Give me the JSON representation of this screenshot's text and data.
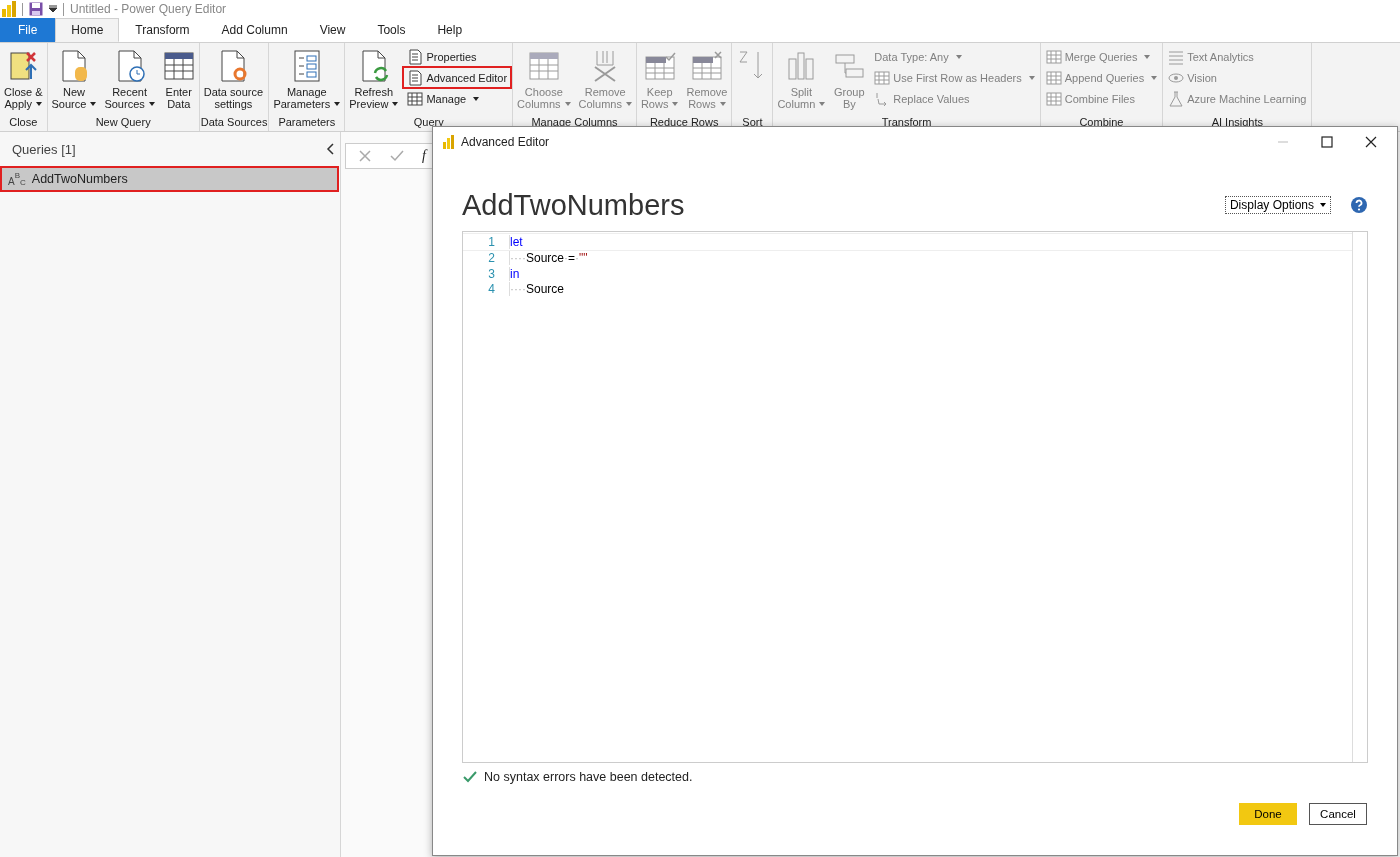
{
  "title_bar": {
    "title": "Untitled - Power Query Editor"
  },
  "tabs": [
    {
      "label": "File",
      "kind": "file",
      "selected": false
    },
    {
      "label": "Home",
      "kind": "tab",
      "selected": true
    },
    {
      "label": "Transform",
      "kind": "tab",
      "selected": false
    },
    {
      "label": "Add Column",
      "kind": "tab",
      "selected": false
    },
    {
      "label": "View",
      "kind": "tab",
      "selected": false
    },
    {
      "label": "Tools",
      "kind": "tab",
      "selected": false
    },
    {
      "label": "Help",
      "kind": "tab",
      "selected": false
    }
  ],
  "ribbon_groups": [
    {
      "label": "Close",
      "items": [
        {
          "kind": "large",
          "lines": [
            "Close &",
            "Apply"
          ],
          "dropdown": true,
          "disabled": false,
          "highlighted": false
        }
      ]
    },
    {
      "label": "New Query",
      "items": [
        {
          "kind": "large",
          "lines": [
            "New",
            "Source"
          ],
          "dropdown": true,
          "disabled": false,
          "highlighted": false
        },
        {
          "kind": "large",
          "lines": [
            "Recent",
            "Sources"
          ],
          "dropdown": true,
          "disabled": false,
          "highlighted": false
        },
        {
          "kind": "large",
          "lines": [
            "Enter",
            "Data"
          ],
          "dropdown": false,
          "disabled": false,
          "highlighted": false
        }
      ]
    },
    {
      "label": "Data Sources",
      "items": [
        {
          "kind": "large",
          "lines": [
            "Data source",
            "settings"
          ],
          "dropdown": false,
          "disabled": false,
          "highlighted": false
        }
      ]
    },
    {
      "label": "Parameters",
      "items": [
        {
          "kind": "large",
          "lines": [
            "Manage",
            "Parameters"
          ],
          "dropdown": true,
          "disabled": false,
          "highlighted": false
        }
      ]
    },
    {
      "label": "Query",
      "items": [
        {
          "kind": "large",
          "lines": [
            "Refresh",
            "Preview"
          ],
          "dropdown": true,
          "disabled": false,
          "highlighted": false
        },
        {
          "kind": "small",
          "lines": [
            "Properties"
          ],
          "dropdown": false,
          "disabled": false,
          "highlighted": false
        },
        {
          "kind": "small",
          "lines": [
            "Advanced Editor"
          ],
          "dropdown": false,
          "disabled": false,
          "highlighted": true
        },
        {
          "kind": "small",
          "lines": [
            "Manage"
          ],
          "dropdown": true,
          "disabled": false,
          "highlighted": false
        }
      ]
    },
    {
      "label": "Manage Columns",
      "items": [
        {
          "kind": "large",
          "lines": [
            "Choose",
            "Columns"
          ],
          "dropdown": true,
          "disabled": true,
          "highlighted": false
        },
        {
          "kind": "large",
          "lines": [
            "Remove",
            "Columns"
          ],
          "dropdown": true,
          "disabled": true,
          "highlighted": false
        }
      ]
    },
    {
      "label": "Reduce Rows",
      "items": [
        {
          "kind": "large",
          "lines": [
            "Keep",
            "Rows"
          ],
          "dropdown": true,
          "disabled": true,
          "highlighted": false
        },
        {
          "kind": "large",
          "lines": [
            "Remove",
            "Rows"
          ],
          "dropdown": true,
          "disabled": true,
          "highlighted": false
        }
      ]
    },
    {
      "label": "Sort",
      "items": [
        {
          "kind": "sort",
          "disabled": true,
          "highlighted": false
        }
      ]
    },
    {
      "label": "Transform",
      "items": [
        {
          "kind": "large",
          "lines": [
            "Split",
            "Column"
          ],
          "dropdown": true,
          "disabled": true,
          "highlighted": false
        },
        {
          "kind": "large",
          "lines": [
            "Group",
            "By"
          ],
          "dropdown": false,
          "disabled": true,
          "highlighted": false
        },
        {
          "kind": "small",
          "lines": [
            "Data Type: Any"
          ],
          "dropdown": true,
          "disabled": true,
          "highlighted": false
        },
        {
          "kind": "small",
          "lines": [
            "Use First Row as Headers"
          ],
          "dropdown": true,
          "disabled": true,
          "highlighted": false
        },
        {
          "kind": "small",
          "lines": [
            "Replace Values"
          ],
          "dropdown": false,
          "disabled": true,
          "highlighted": false
        }
      ]
    },
    {
      "label": "Combine",
      "items": [
        {
          "kind": "small",
          "lines": [
            "Merge Queries"
          ],
          "dropdown": true,
          "disabled": true,
          "highlighted": false
        },
        {
          "kind": "small",
          "lines": [
            "Append Queries"
          ],
          "dropdown": true,
          "disabled": true,
          "highlighted": false
        },
        {
          "kind": "small",
          "lines": [
            "Combine Files"
          ],
          "dropdown": false,
          "disabled": true,
          "highlighted": false
        }
      ]
    },
    {
      "label": "AI Insights",
      "items": [
        {
          "kind": "small",
          "lines": [
            "Text Analytics"
          ],
          "dropdown": false,
          "disabled": true,
          "highlighted": false
        },
        {
          "kind": "small",
          "lines": [
            "Vision"
          ],
          "dropdown": false,
          "disabled": true,
          "highlighted": false
        },
        {
          "kind": "small",
          "lines": [
            "Azure Machine Learning"
          ],
          "dropdown": false,
          "disabled": true,
          "highlighted": false
        }
      ]
    }
  ],
  "queries_pane": {
    "header": "Queries [1]",
    "items": [
      {
        "name": "AddTwoNumbers",
        "type_icon_letters": [
          "A",
          "B",
          "C"
        ],
        "selected": true,
        "highlighted": true
      }
    ]
  },
  "formula_bar": {
    "fx_label": "f"
  },
  "dialog": {
    "title": "Advanced Editor",
    "heading": "AddTwoNumbers",
    "display_options": "Display Options",
    "code_lines": [
      {
        "number": "1",
        "tokens": [
          {
            "kind": "keyword",
            "text": "let"
          }
        ]
      },
      {
        "number": "2",
        "tokens": [
          {
            "kind": "whitespace",
            "text": "····"
          },
          {
            "kind": "ident",
            "text": "Source"
          },
          {
            "kind": "whitespace",
            "text": "·"
          },
          {
            "kind": "ident",
            "text": "="
          },
          {
            "kind": "whitespace",
            "text": "·"
          },
          {
            "kind": "string",
            "text": "\"\""
          }
        ]
      },
      {
        "number": "3",
        "tokens": [
          {
            "kind": "keyword",
            "text": "in"
          }
        ]
      },
      {
        "number": "4",
        "tokens": [
          {
            "kind": "whitespace",
            "text": "····"
          },
          {
            "kind": "ident",
            "text": "Source"
          }
        ]
      }
    ],
    "status": "No syntax errors have been detected.",
    "buttons": [
      {
        "label": "Done",
        "kind": "primary"
      },
      {
        "label": "Cancel",
        "kind": "secondary"
      }
    ]
  }
}
